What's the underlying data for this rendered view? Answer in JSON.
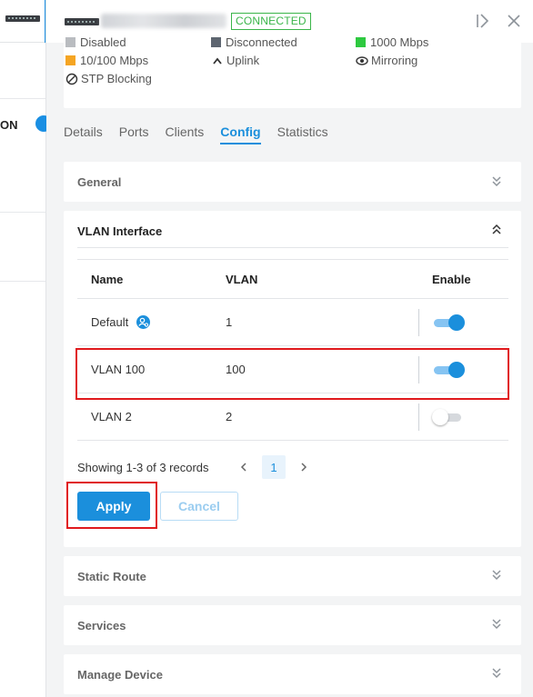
{
  "header": {
    "status": "CONNECTED"
  },
  "legend": {
    "items": [
      {
        "label": "Disabled",
        "color": "#b9bcc0"
      },
      {
        "label": "Disconnected",
        "color": "#5d6570"
      },
      {
        "label": "1000 Mbps",
        "color": "#2ec940"
      },
      {
        "label": "10/100 Mbps",
        "color": "#f5a523"
      },
      {
        "label": "Uplink",
        "icon": "chevron-up-icon"
      },
      {
        "label": "Mirroring",
        "icon": "eye-icon"
      },
      {
        "label": "STP Blocking",
        "icon": "blocked-icon"
      }
    ]
  },
  "background": {
    "partial_label": "ON"
  },
  "tabs": [
    {
      "label": "Details",
      "active": false
    },
    {
      "label": "Ports",
      "active": false
    },
    {
      "label": "Clients",
      "active": false
    },
    {
      "label": "Config",
      "active": true
    },
    {
      "label": "Statistics",
      "active": false
    }
  ],
  "sections": {
    "general": "General",
    "vlan_interface": "VLAN Interface",
    "static_route": "Static Route",
    "services": "Services",
    "manage_device": "Manage Device"
  },
  "vlan_table": {
    "columns": {
      "name": "Name",
      "vlan": "VLAN",
      "enable": "Enable"
    },
    "rows": [
      {
        "name": "Default",
        "vlan": "1",
        "enabled": true,
        "info_icon": true
      },
      {
        "name": "VLAN 100",
        "vlan": "100",
        "enabled": true,
        "info_icon": false
      },
      {
        "name": "VLAN 2",
        "vlan": "2",
        "enabled": false,
        "info_icon": false
      }
    ]
  },
  "pagination": {
    "summary": "Showing 1-3 of 3 records",
    "current_page": "1"
  },
  "buttons": {
    "apply": "Apply",
    "cancel": "Cancel"
  },
  "colors": {
    "accent": "#1b8fdc",
    "connected": "#3bb54a",
    "highlight": "#e0191d"
  }
}
